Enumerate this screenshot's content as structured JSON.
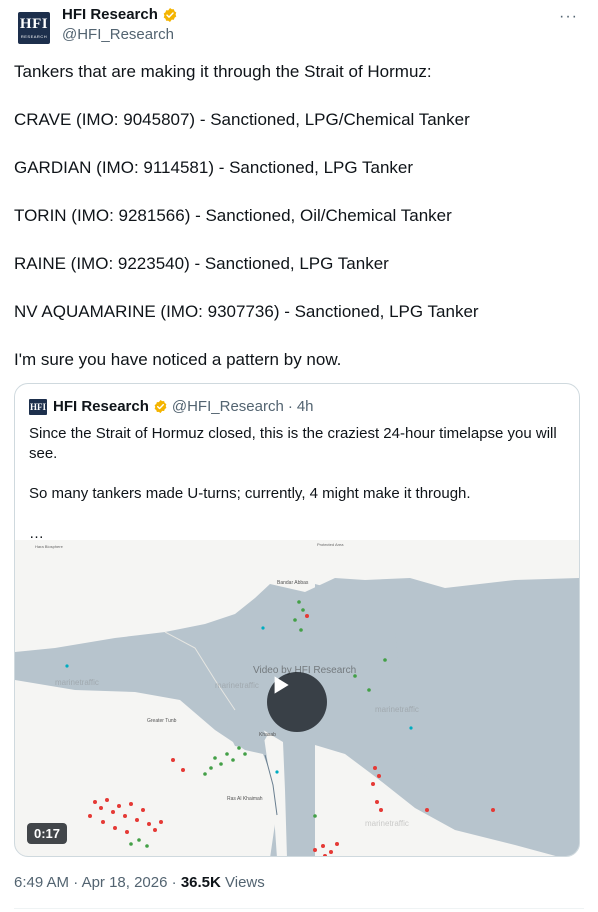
{
  "author": {
    "name": "HFI Research",
    "handle": "@HFI_Research",
    "logo_text": "HFI",
    "logo_subtext": "RESEARCH"
  },
  "more_label": "···",
  "tweet": {
    "paragraphs": [
      "Tankers that are making it through the Strait of Hormuz:",
      "CRAVE (IMO: 9045807) - Sanctioned, LPG/Chemical Tanker",
      "GARDIAN (IMO: 9114581) - Sanctioned, LPG Tanker",
      "TORIN (IMO: 9281566) - Sanctioned, Oil/Chemical Tanker",
      "RAINE (IMO: 9223540) - Sanctioned, LPG Tanker",
      "NV AQUAMARINE (IMO: 9307736) - Sanctioned, LPG Tanker",
      "I'm sure you have noticed a pattern by now."
    ]
  },
  "quote": {
    "name": "HFI Research",
    "handle": "@HFI_Research",
    "separator": "·",
    "time": "4h",
    "paragraphs": [
      "Since the Strait of Hormuz closed, this is the craziest 24-hour timelapse you will see.",
      "So many tankers made U-turns; currently, 4 might make it through.",
      "…"
    ],
    "video": {
      "duration": "0:17",
      "watermark": "Video by HFI Research"
    }
  },
  "meta": {
    "time": "6:49 AM",
    "separator": "·",
    "date": "Apr 18, 2026",
    "views_count": "36.5K",
    "views_label": "Views"
  },
  "colors": {
    "verified_badge": "#f4b400",
    "text_primary": "#0f1419",
    "text_secondary": "#536471",
    "border": "#cfd9de",
    "sea": "#b7c4cd",
    "land": "#f5f5f3"
  }
}
